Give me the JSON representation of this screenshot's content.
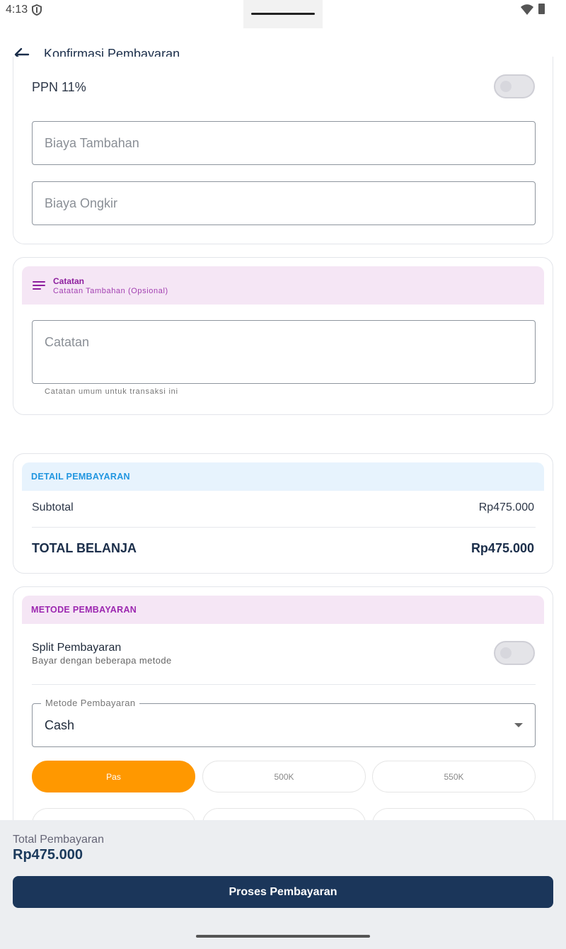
{
  "status_bar": {
    "time": "4:13"
  },
  "app_bar": {
    "title": "Konfirmasi Pembayaran"
  },
  "tax": {
    "ppn_label": "PPN 11%",
    "additional_fee_placeholder": "Biaya Tambahan",
    "shipping_fee_placeholder": "Biaya Ongkir"
  },
  "notes": {
    "title": "Catatan",
    "subtitle": "Catatan Tambahan (Opsional)",
    "field_placeholder": "Catatan",
    "helper": "Catatan umum untuk transaksi ini"
  },
  "payment_detail": {
    "header": "DETAIL PEMBAYARAN",
    "subtotal_label": "Subtotal",
    "subtotal_value": "Rp475.000",
    "total_label": "TOTAL BELANJA",
    "total_value": "Rp475.000"
  },
  "payment_method": {
    "header": "METODE PEMBAYARAN",
    "split_title": "Split Pembayaran",
    "split_subtitle": "Bayar dengan beberapa metode",
    "select_label": "Metode Pembayaran",
    "select_value": "Cash",
    "quick_amounts": [
      "Pas",
      "500K",
      "550K"
    ]
  },
  "bottom": {
    "total_label": "Total Pembayaran",
    "total_value": "Rp475.000",
    "process_button": "Proses Pembayaran"
  },
  "colors": {
    "primary": "#1b365a",
    "accent_orange": "#ff9800",
    "purple": "#9c27b0",
    "blue": "#2196e0"
  }
}
